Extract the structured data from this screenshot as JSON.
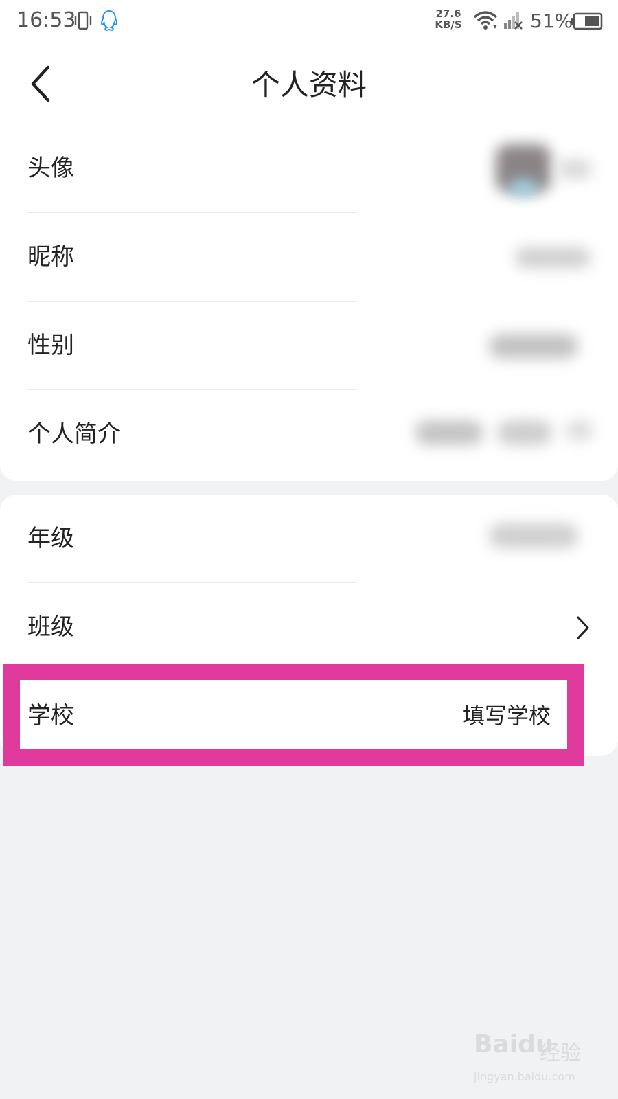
{
  "status_bar": {
    "time": "16:53",
    "net_speed_value": "27.6",
    "net_speed_unit": "KB/S",
    "battery_percent": "51%",
    "icons": [
      "vibrate-icon",
      "qq-icon",
      "wifi-icon",
      "signal-icon",
      "battery-icon"
    ]
  },
  "header": {
    "title": "个人资料",
    "back_icon": "chevron-left-icon"
  },
  "profile_rows": [
    {
      "label": "头像"
    },
    {
      "label": "昵称"
    },
    {
      "label": "性别"
    },
    {
      "label": "个人简介"
    }
  ],
  "school_rows": [
    {
      "label": "年级"
    },
    {
      "label": "班级"
    },
    {
      "label": "学校",
      "value": "填写学校"
    }
  ],
  "watermark": {
    "logo": "Bai",
    "logo_suffix": "du",
    "text": "经验",
    "url": "jingyan.baidu.com"
  },
  "colors": {
    "highlight": "#e03a9c",
    "background": "#f1f2f4",
    "card": "#ffffff",
    "qq_blue": "#1e9be8"
  }
}
